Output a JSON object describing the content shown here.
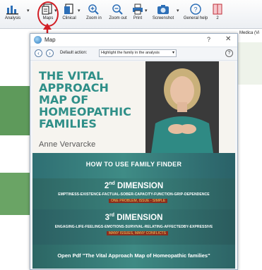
{
  "toolbar": {
    "analysis_label": "Analysis",
    "maps_label": "Maps",
    "clinical_label": "Clinical",
    "zoom_in_label": "Zoom in",
    "zoom_out_label": "Zoom out",
    "print_label": "Print",
    "screenshot_label": "Screenshot",
    "general_help_label": "General help",
    "extra_label": "2"
  },
  "background": {
    "right_label": "Medica (Vi"
  },
  "map_window": {
    "title": "Map",
    "help_glyph": "?",
    "close_glyph": "✕",
    "default_action_label": "Default action:",
    "default_action_value": "Highlight the family in the analysis",
    "help_circle_glyph": "?"
  },
  "cover": {
    "title_lines": [
      "THE VITAL",
      "APPROACH",
      "MAP OF",
      "HOMEOPATHIC",
      "FAMILIES"
    ],
    "author": "Anne Vervarcke"
  },
  "sections": {
    "how_to": "HOW TO USE FAMILY FINDER",
    "second": {
      "num": "2",
      "sup": "nd",
      "label": "DIMENSION",
      "words": "EMPTINESS-EXISTENCE-FACTUAL-SOBER-CAPACITY-FUNCTION-GRIP-DEPENDENCE",
      "tag": "ONE PROBLEM, ISSUE - SIMPLE"
    },
    "third": {
      "num": "3",
      "sup": "rd",
      "label": "DIMENSION",
      "words": "ENGAGING-LIFE-FEELINGS-EMOTIONS-SURVIVAL-RELATING-AFFECTEDBY-EXPRESSIVE",
      "tag": "MANY ISSUES, MANY CONFLICTS"
    },
    "pdf": "Open Pdf \"The Vital Approach Map of Homeopathic families\""
  },
  "colors": {
    "teal_title": "#2f8f88",
    "section_teal": "#3a827c",
    "highlight_red": "#d21f26"
  }
}
